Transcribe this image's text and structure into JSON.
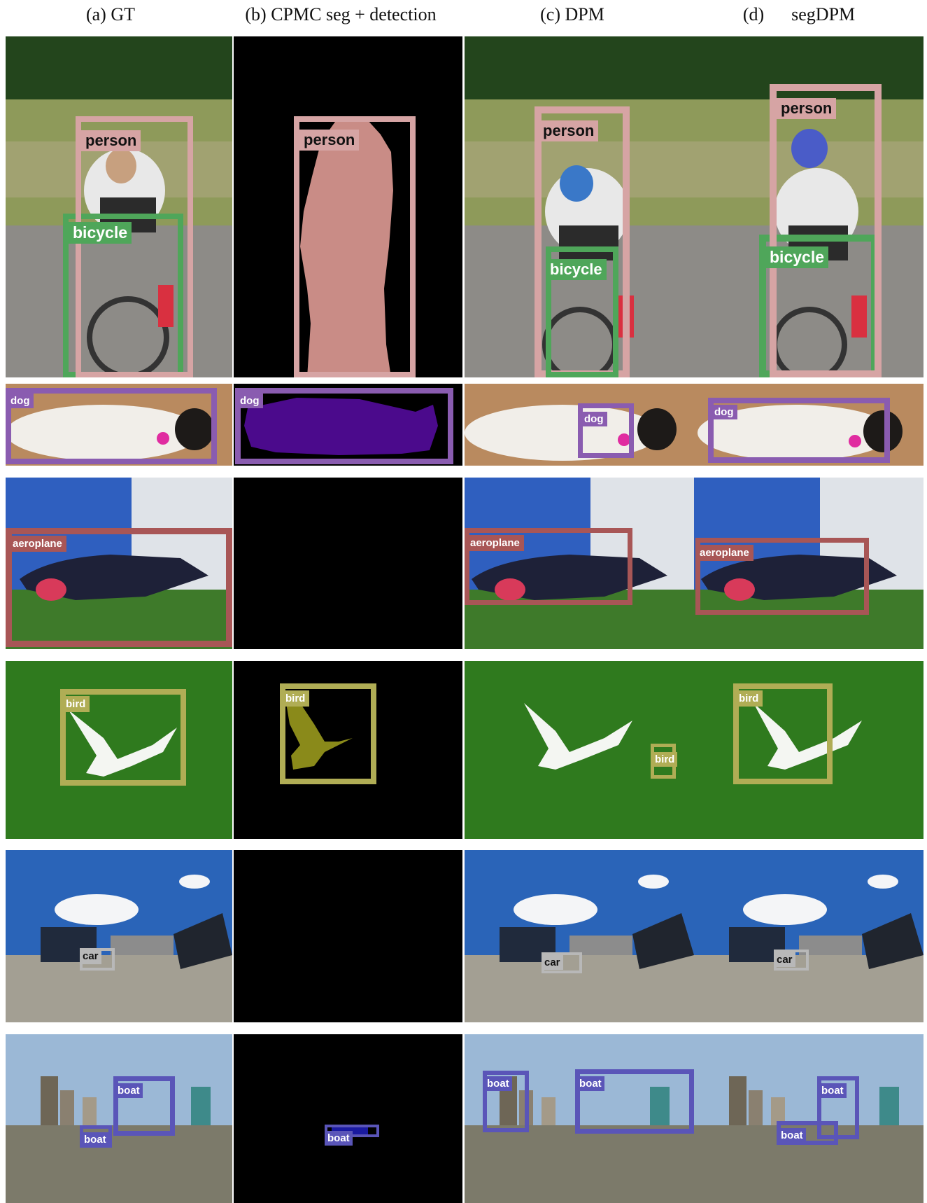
{
  "columns": [
    {
      "key": "gt",
      "header": "(a) GT"
    },
    {
      "key": "cpmc",
      "header": "(b) CPMC seg + detection"
    },
    {
      "key": "dpm",
      "header": "(c) DPM"
    },
    {
      "key": "segdpm",
      "header": "(d)      segDPM"
    }
  ],
  "colors": {
    "person": "#d6a4a4",
    "bicycle": "#4fa65a",
    "dog": "#8a5cb0",
    "aeroplane": "#a85656",
    "bird": "#b0ad55",
    "car": "#b8b8b8",
    "boat": "#5a55b8",
    "mask_person": "#c98c86",
    "mask_dog": "#4b0a8c",
    "mask_bird": "#8a8a1a"
  },
  "labels": {
    "person": "person",
    "bicycle": "bicycle",
    "dog": "dog",
    "aeroplane": "aeroplane",
    "bird": "bird",
    "car": "car",
    "boat": "boat"
  },
  "rows": [
    {
      "scene": "cyclist"
    },
    {
      "scene": "dog"
    },
    {
      "scene": "aeroplane"
    },
    {
      "scene": "bird"
    },
    {
      "scene": "car"
    },
    {
      "scene": "boat"
    }
  ]
}
